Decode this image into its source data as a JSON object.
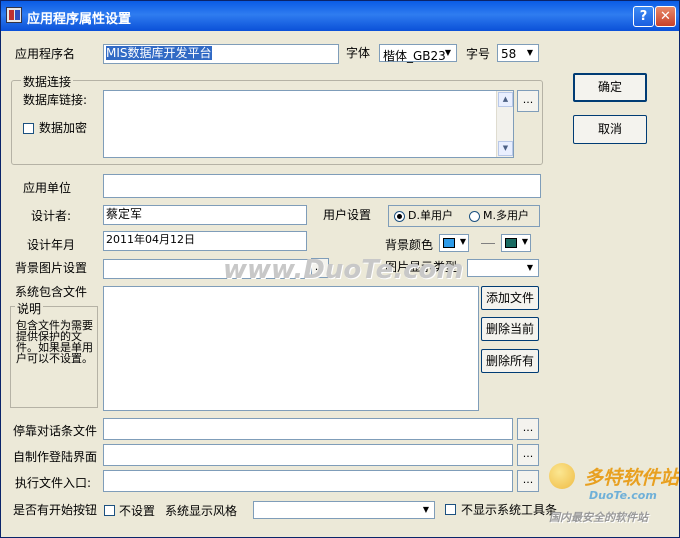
{
  "window": {
    "title": "应用程序属性设置",
    "help_label": "?",
    "close_label": "✕"
  },
  "app": {
    "name_label": "应用程序名",
    "name_value": "MIS数据库开发平台",
    "font_label": "字体",
    "font_value": "楷体_GB23",
    "size_label": "字号",
    "size_value": "58"
  },
  "db": {
    "group_title": "数据连接",
    "link_label": "数据库链接:",
    "encrypt_label": "数据加密",
    "browse_label": "..."
  },
  "buttons": {
    "ok": "确定",
    "cancel": "取消",
    "add_file": "添加文件",
    "delete_current": "删除当前",
    "delete_all": "删除所有"
  },
  "fields": {
    "unit_label": "应用单位",
    "unit_value": "",
    "designer_label": "设计者:",
    "designer_value": "蔡定军",
    "design_date_label": "设计年月",
    "design_date_value": "2011年04月12日",
    "bg_image_label": "背景图片设置",
    "bg_image_browse": "...",
    "image_display_label": "图片显示类型",
    "image_display_value": "",
    "include_files_label": "系统包含文件"
  },
  "user_settings": {
    "label": "用户设置",
    "single": "D.单用户",
    "multi": "M.多用户",
    "selected": "single"
  },
  "bg_color": {
    "label": "背景颜色",
    "color1": "#2e9be8",
    "color2": "#1a6b62"
  },
  "note": {
    "title": "说明",
    "body": "包含文件为需要提供保护的文件。如果是单用户可以不设置。"
  },
  "bottom": {
    "dock_label": "停靠对话条文件",
    "login_label": "自制作登陆界面",
    "exec_label": "执行文件入口:",
    "dock_browse": "...",
    "login_browse": "...",
    "exec_browse": "...",
    "start_btn_label": "是否有开始按钮",
    "no_setting_label": "不设置",
    "style_label": "系统显示风格",
    "style_value": "",
    "hide_toolbar_label": "不显示系统工具条"
  },
  "watermark": {
    "site": "www.DuoTe.com",
    "brand": "多特软件站",
    "brand_url": "DuoTe.com",
    "slogan": "国内最安全的软件站"
  },
  "colors": {
    "titlebar": "#0a5ce6",
    "face": "#ece9d8",
    "selection": "#316ac5"
  }
}
